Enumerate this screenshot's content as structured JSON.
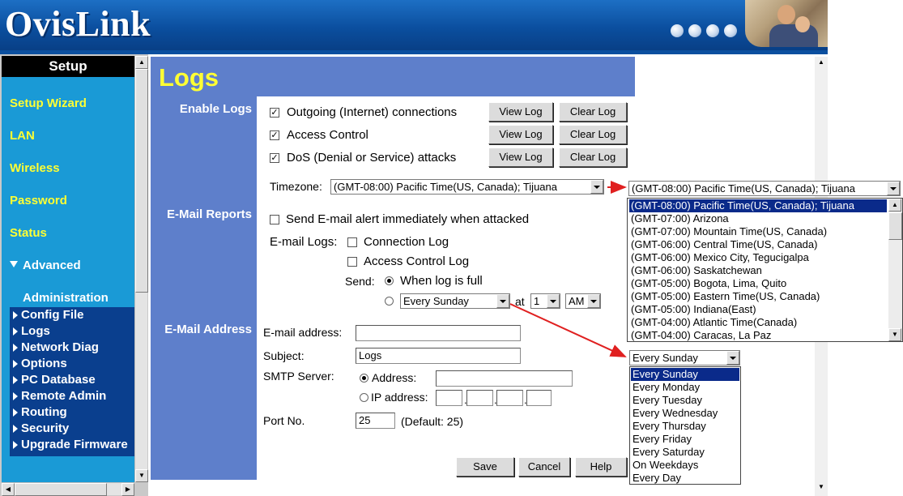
{
  "brand": {
    "logo": "OvisLink"
  },
  "sidebar": {
    "title": "Setup",
    "links": [
      "Setup Wizard",
      "LAN",
      "Wireless",
      "Password",
      "Status"
    ],
    "advanced": "Advanced",
    "administration": "Administration",
    "submenu": [
      "Config File",
      "Logs",
      "Network Diag",
      "Options",
      "PC Database",
      "Remote Admin",
      "Routing",
      "Security",
      "Upgrade Firmware"
    ]
  },
  "page": {
    "title": "Logs",
    "sections": {
      "enable_logs": "Enable Logs",
      "email_reports": "E-Mail Reports",
      "email_address": "E-Mail Address"
    }
  },
  "enable_logs": {
    "rows": [
      {
        "label": "Outgoing (Internet) connections",
        "checked": true
      },
      {
        "label": "Access Control",
        "checked": true
      },
      {
        "label": "DoS (Denial or Service) attacks",
        "checked": true
      }
    ],
    "view_label": "View Log",
    "clear_label": "Clear Log",
    "timezone_label": "Timezone:",
    "timezone_value": "(GMT-08:00) Pacific Time(US, Canada); Tijuana"
  },
  "email_reports": {
    "alert_label": "Send E-mail alert immediately when attacked",
    "alert_checked": false,
    "email_logs_label": "E-mail Logs:",
    "connection_log": "Connection Log",
    "access_control_log": "Access Control Log",
    "send_label": "Send:",
    "when_full": "When log is full",
    "day_value": "Every Sunday",
    "at_label": "at",
    "hour_value": "1",
    "ampm_value": "AM"
  },
  "email_address": {
    "address_label": "E-mail address:",
    "address_value": "",
    "subject_label": "Subject:",
    "subject_value": "Logs",
    "smtp_label": "SMTP Server:",
    "address_radio": "Address:",
    "ip_radio": "IP address:",
    "port_label": "Port No.",
    "port_value": "25",
    "port_default": "(Default: 25)"
  },
  "actions": {
    "save": "Save",
    "cancel": "Cancel",
    "help": "Help"
  },
  "timezone_dropdown": {
    "selected": "(GMT-08:00) Pacific Time(US, Canada); Tijuana",
    "options": [
      "(GMT-08:00) Pacific Time(US, Canada); Tijuana",
      "(GMT-07:00) Arizona",
      "(GMT-07:00) Mountain Time(US, Canada)",
      "(GMT-06:00) Central Time(US, Canada)",
      "(GMT-06:00) Mexico City, Tegucigalpa",
      "(GMT-06:00) Saskatchewan",
      "(GMT-05:00) Bogota, Lima, Quito",
      "(GMT-05:00) Eastern Time(US, Canada)",
      "(GMT-05:00) Indiana(East)",
      "(GMT-04:00) Atlantic Time(Canada)",
      "(GMT-04:00) Caracas, La Paz"
    ]
  },
  "day_dropdown": {
    "selected": "Every Sunday",
    "options": [
      "Every Sunday",
      "Every Monday",
      "Every Tuesday",
      "Every Wednesday",
      "Every Thursday",
      "Every Friday",
      "Every Saturday",
      "On Weekdays",
      "Every Day"
    ]
  },
  "colors": {
    "banner": "#0b4f9f",
    "sidebar": "#1a9ad6",
    "link": "#ffff33",
    "panel": "#5e7fcb",
    "highlight": "#0a2a8a",
    "arrow": "#e02020"
  }
}
